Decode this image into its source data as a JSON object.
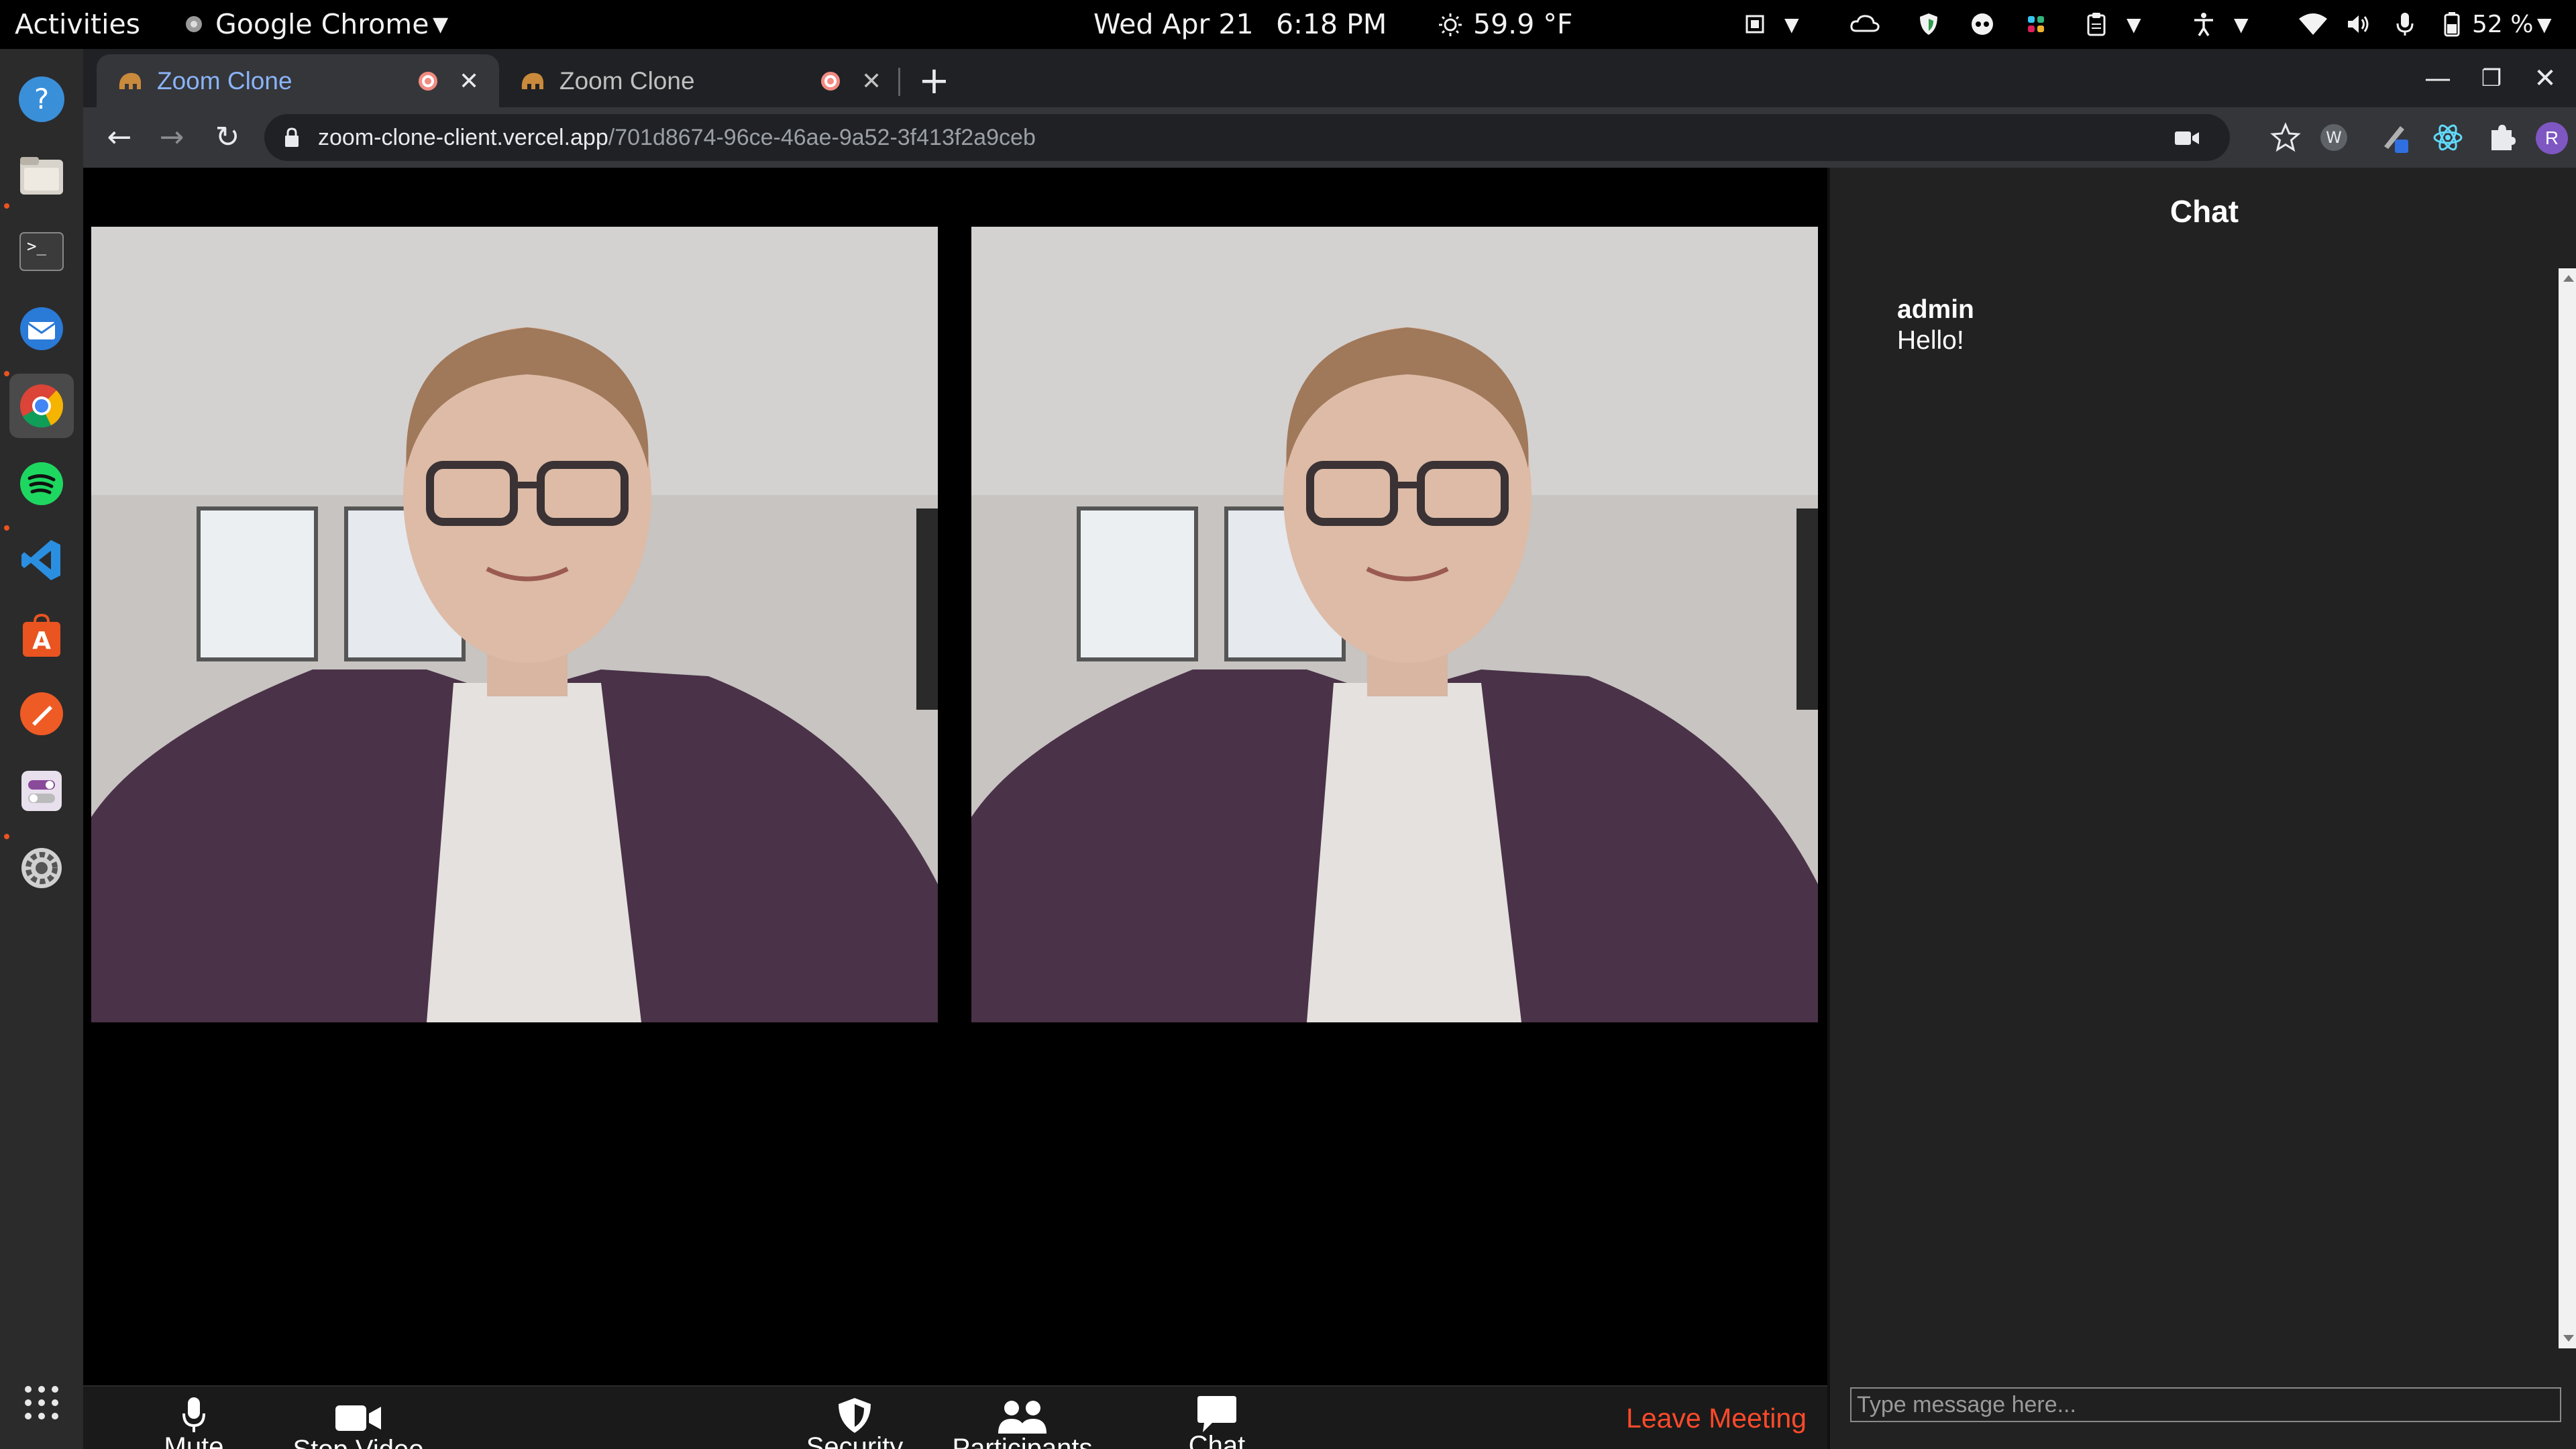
{
  "topbar": {
    "activities": "Activities",
    "app_menu": "Google Chrome",
    "date": "Wed Apr 21",
    "time": "6:18 PM",
    "weather": "59.9 °F",
    "battery": "52 %"
  },
  "tabs": [
    {
      "title": "Zoom Clone",
      "active": true
    },
    {
      "title": "Zoom Clone",
      "active": false
    }
  ],
  "omnibox": {
    "host": "zoom-clone-client.vercel.app",
    "path": "/701d8674-96ce-46ae-9a52-3f413f2a9ceb"
  },
  "profile_initial": "R",
  "controls": {
    "mute": "Mute",
    "stop_video": "Stop Video",
    "security": "Security",
    "participants": "Participants",
    "chat": "Chat",
    "leave": "Leave Meeting"
  },
  "chat": {
    "title": "Chat",
    "messages": [
      {
        "author": "admin",
        "text": "Hello!"
      }
    ],
    "input_placeholder": "Type message here..."
  },
  "colors": {
    "leave_red": "#ff4a2a",
    "tab_active_text": "#8ab4f8",
    "ubuntu_orange": "#e95420"
  }
}
